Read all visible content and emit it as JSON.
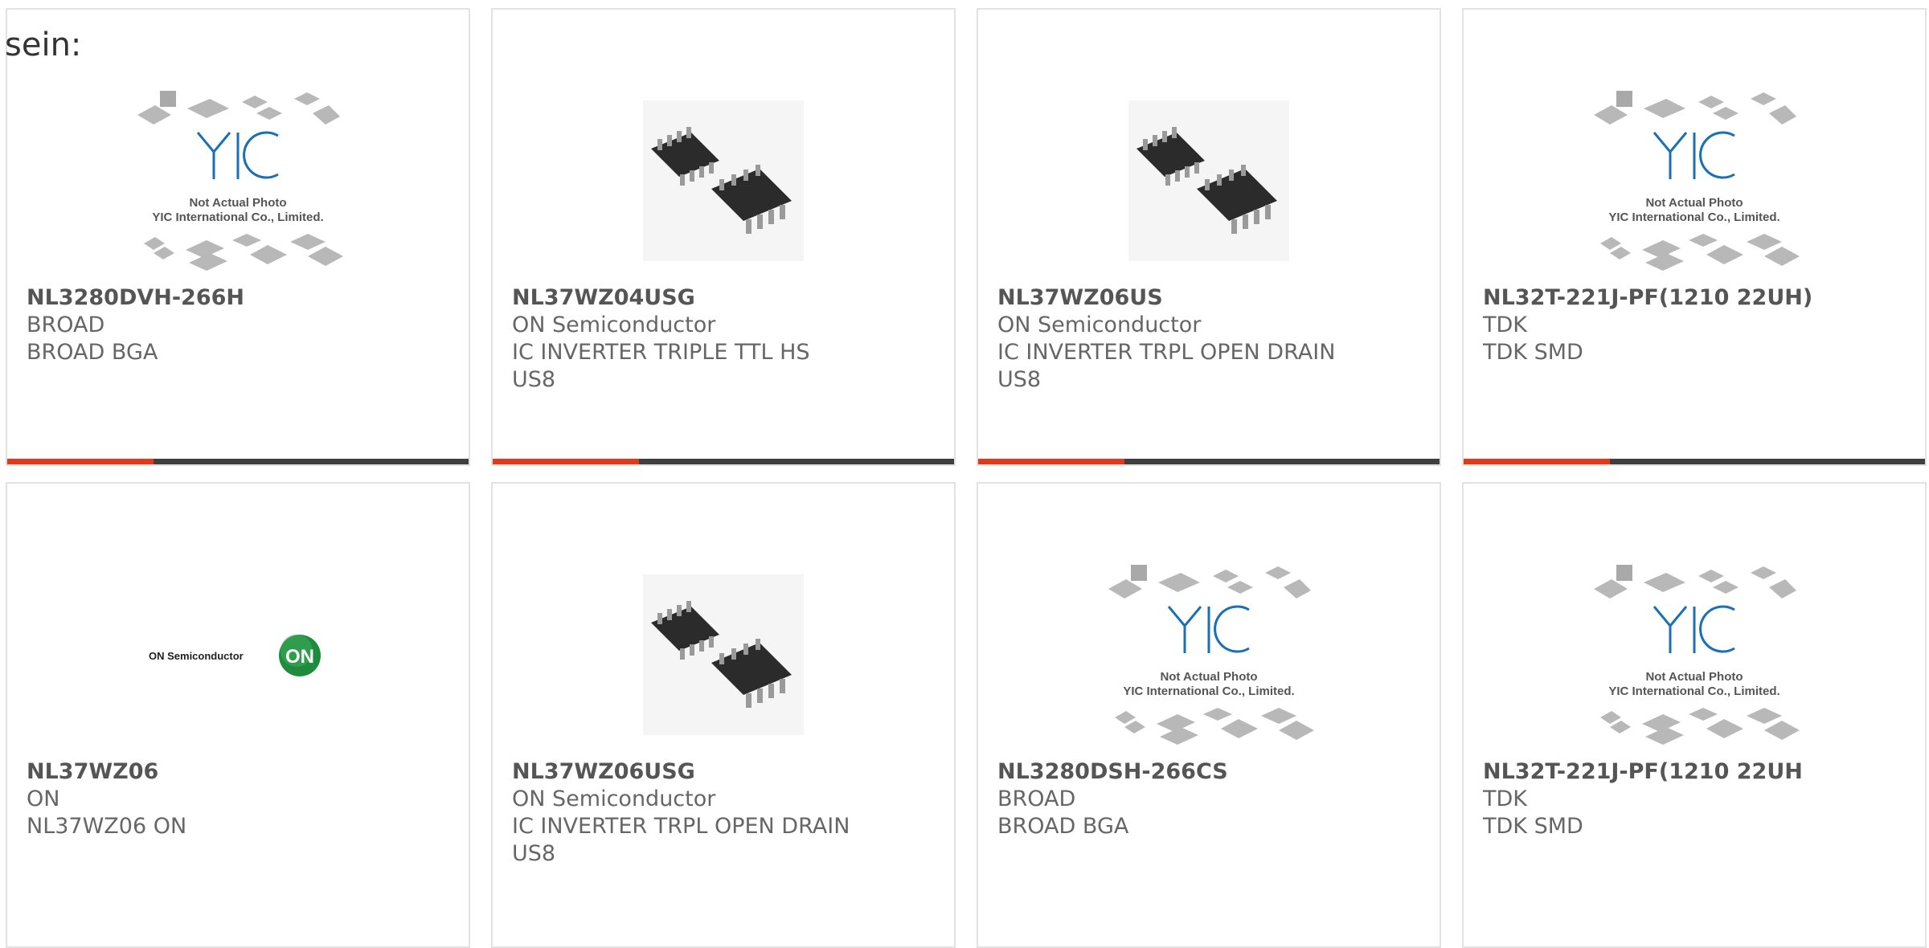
{
  "heading": "sein:",
  "colors": {
    "accent_bar": "#e03a1a",
    "dark_bar": "#3f3f3f",
    "card_border": "#e2e2e2",
    "yic_logo": "#1a6fb5",
    "on_logo": "#1e8c3c"
  },
  "products": [
    {
      "part": "NL3280DVH-266H",
      "manufacturer": "BROAD",
      "description": "BROAD BGA",
      "image": "yic-placeholder-icon"
    },
    {
      "part": "NL37WZ04USG",
      "manufacturer": "ON Semiconductor",
      "description": "IC INVERTER TRIPLE TTL HS US8",
      "image": "ic-chip-icon"
    },
    {
      "part": "NL37WZ06US",
      "manufacturer": "ON Semiconductor",
      "description": "IC INVERTER TRPL OPEN DRAIN US8",
      "image": "ic-chip-icon"
    },
    {
      "part": "NL32T-221J-PF(1210 22UH)",
      "manufacturer": "TDK",
      "description": "TDK SMD",
      "image": "yic-placeholder-icon"
    },
    {
      "part": "NL37WZ06",
      "manufacturer": "ON",
      "description": "NL37WZ06 ON",
      "image": "on-semiconductor-logo"
    },
    {
      "part": "NL37WZ06USG",
      "manufacturer": "ON Semiconductor",
      "description": "IC INVERTER TRPL OPEN DRAIN US8",
      "image": "ic-chip-icon"
    },
    {
      "part": "NL3280DSH-266CS",
      "manufacturer": "BROAD",
      "description": "BROAD BGA",
      "image": "yic-placeholder-icon"
    },
    {
      "part": "NL32T-221J-PF(1210 22UH",
      "manufacturer": "TDK",
      "description": "TDK SMD",
      "image": "yic-placeholder-icon"
    }
  ],
  "placeholder": {
    "logo_text": "YIC",
    "line1": "Not Actual Photo",
    "line2": "YIC International Co., Limited."
  },
  "on_logo": {
    "wordmark": "ON Semiconductor",
    "badge": "ON"
  }
}
